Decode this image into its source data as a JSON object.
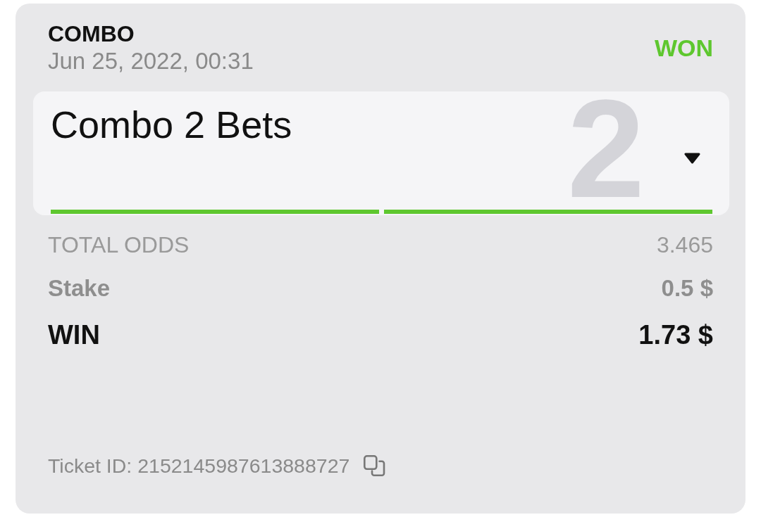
{
  "ticket": {
    "type_label": "COMBO",
    "date": "Jun 25, 2022, 00:31",
    "status": "WON",
    "won": true,
    "combo": {
      "title": "Combo 2 Bets",
      "count": "2",
      "expanded": false,
      "legs": [
        {
          "won": true
        },
        {
          "won": true
        }
      ]
    },
    "rows": [
      {
        "kind": "odds",
        "label": "TOTAL ODDS",
        "value": "3.465"
      },
      {
        "kind": "stake",
        "label": "Stake",
        "value": "0.5 $"
      },
      {
        "kind": "win",
        "label": "WIN",
        "value": "1.73 $"
      }
    ],
    "ticket_id": "Ticket ID: 2152145987613888727"
  }
}
